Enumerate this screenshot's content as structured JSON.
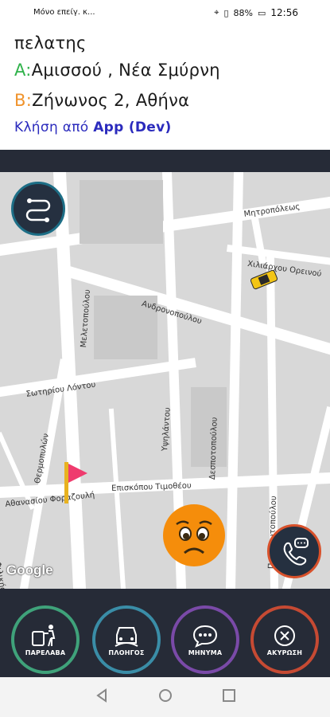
{
  "status_bar": {
    "notification_text": "Μόνο επείγ. κ...",
    "battery": "88%",
    "time": "12:56"
  },
  "ride": {
    "customer": "πελατης",
    "pickup_letter": "A:",
    "pickup": "Αμισσού , Νέα Σμύρνη",
    "dropoff_letter": "B:",
    "dropoff": "Ζήνωνος 2, Αθήνα",
    "call_prefix": "Κλήση από",
    "call_source": "App (Dev)"
  },
  "map": {
    "streets": [
      "Μητροπόλεως",
      "Χιλιάρχου Ορεινού",
      "Ανδρονοπούλου",
      "Μελετοπούλου",
      "Σωτηρίου Λόντου",
      "Υψηλάντου",
      "Δεσποτοπούλου",
      "Θερμοπυλών",
      "Αθανασίου Φοραζουλή",
      "Επισκόπου Τιμοθέου",
      "Παναγιωτοπούλου",
      "Φιλικής Εταιρείας"
    ],
    "attribution": "Google"
  },
  "actions": {
    "received": "ΠΑΡΕΛΑΒΑ",
    "navigation": "ΠΛΟΗΓΟΣ",
    "message": "ΜΗΝΥΜΑ",
    "cancel": "ΑΚΥΡΩΣΗ"
  },
  "colors": {
    "pickup_letter": "#2fb24a",
    "dropoff_letter": "#f0932b",
    "call_text": "#2b2bbd",
    "dark_bar": "#262b37",
    "received_ring": "#3fa27a",
    "navigation_ring": "#3a8da7",
    "message_ring": "#7a4aa8",
    "cancel_ring": "#c64a33"
  }
}
